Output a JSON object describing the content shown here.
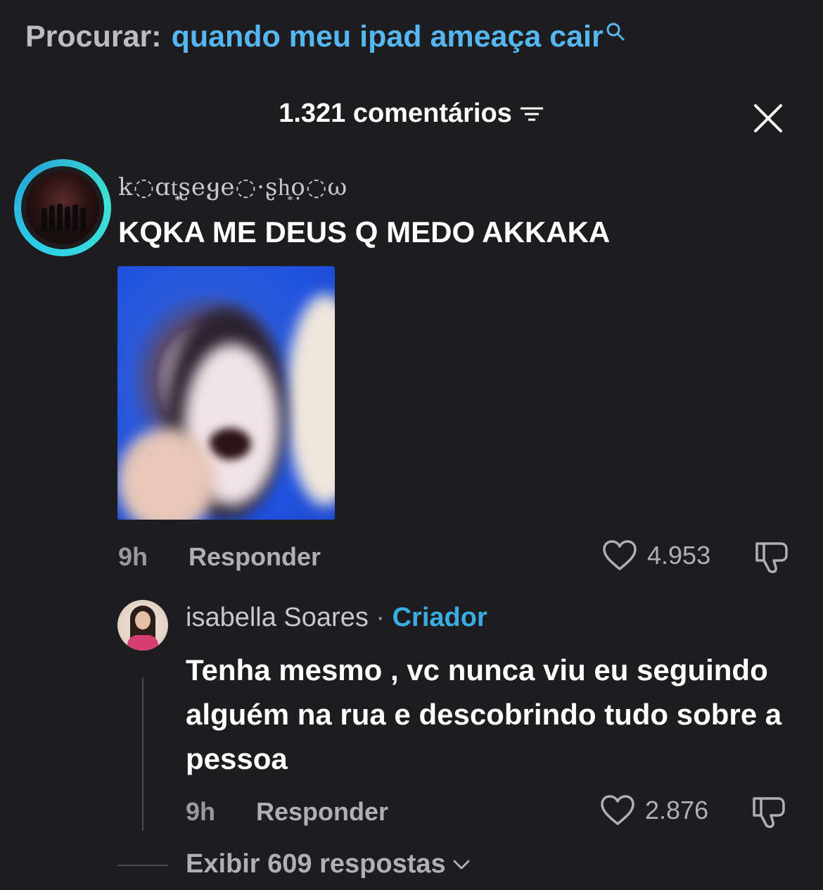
{
  "search": {
    "label": "Procurar:",
    "query": "quando meu ipad ameaça cair"
  },
  "header": {
    "title": "1.321 comentários"
  },
  "comments": [
    {
      "username": "k◌ɑt͎͙ʂeყe◌·ʂh͙ọ◌ω",
      "text": "KQKA ME DEUS Q MEDO AKKAKA",
      "time": "9h",
      "reply_label": "Responder",
      "likes": "4.953"
    },
    {
      "username": "isabella Soares",
      "separator": " · ",
      "badge": "Criador",
      "text": "Tenha mesmo , vc nunca viu eu seguindo alguém na rua e descobrindo tudo sobre a pessoa",
      "time": "9h",
      "reply_label": "Responder",
      "likes": "2.876"
    }
  ],
  "replies_link": "Exibir 609 respostas",
  "colors": {
    "background": "#1d1d1f",
    "link_blue": "#55b6f0",
    "creator_blue": "#3aaee3",
    "ring_cyan": "#2fd0e8"
  },
  "icons": [
    "search-icon",
    "filter-icon",
    "close-icon",
    "heart-icon",
    "dislike-icon",
    "chevron-down-icon"
  ]
}
